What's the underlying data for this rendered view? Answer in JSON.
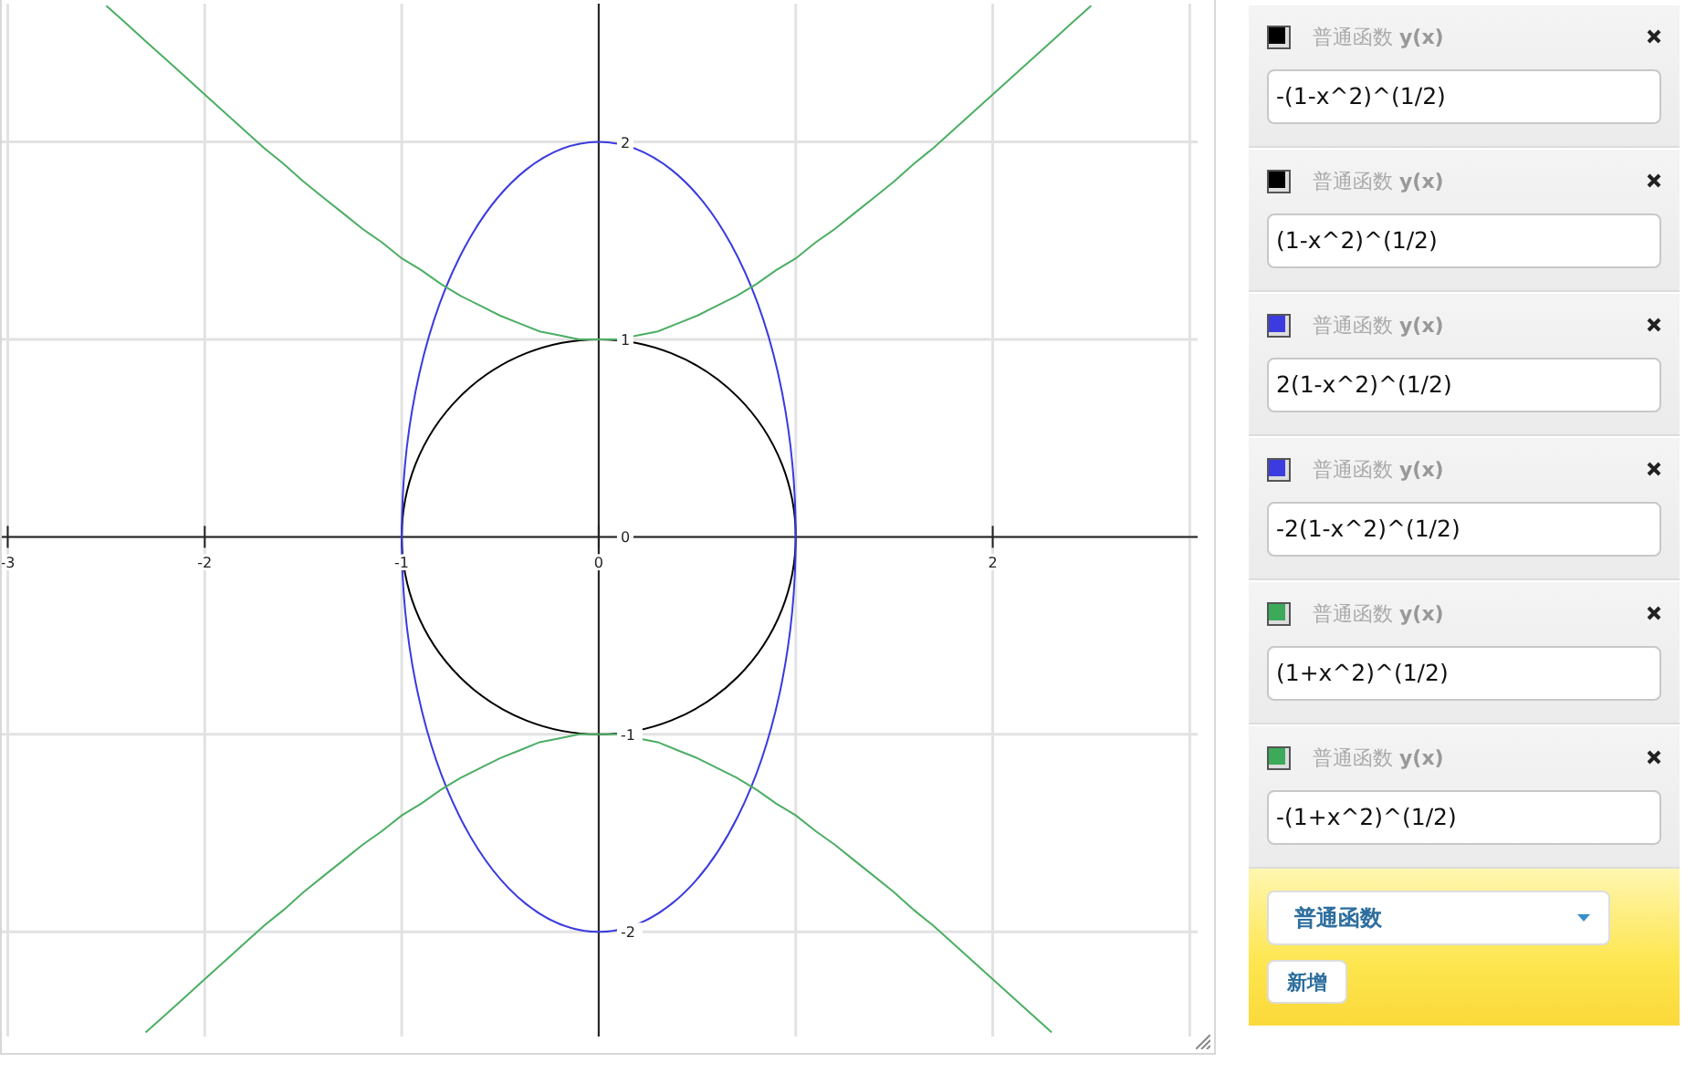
{
  "graph": {
    "chart_data": {
      "type": "line",
      "x": [
        -2.5,
        -2.4,
        -2.3,
        -2.2,
        -2.1,
        -2,
        -1.9,
        -1.8,
        -1.7,
        -1.6,
        -1.5,
        -1.4,
        -1.3,
        -1.2,
        -1.1,
        -1,
        -0.9,
        -0.8,
        -0.7,
        -0.6,
        -0.5,
        -0.4,
        -0.3,
        -0.2,
        -0.1,
        0,
        0.1,
        0.2,
        0.3,
        0.4,
        0.5,
        0.6,
        0.7,
        0.8,
        0.9,
        1,
        1.1,
        1.2,
        1.3,
        1.4,
        1.5,
        1.6,
        1.7,
        1.8,
        1.9,
        2,
        2.1,
        2.2,
        2.3,
        2.4,
        2.5
      ],
      "series": [
        {
          "color": "#4cae64",
          "values": [
            2.69,
            2.6,
            2.51,
            2.42,
            2.33,
            2.24,
            2.15,
            2.06,
            1.97,
            1.89,
            1.8,
            1.72,
            1.64,
            1.56,
            1.49,
            1.41,
            1.35,
            1.28,
            1.22,
            1.17,
            1.12,
            1.08,
            1.04,
            1.02,
            1,
            1,
            1,
            1.02,
            1.04,
            1.08,
            1.12,
            1.17,
            1.22,
            1.28,
            1.35,
            1.41,
            1.49,
            1.56,
            1.64,
            1.72,
            1.8,
            1.89,
            1.97,
            2.06,
            2.15,
            2.24,
            2.33,
            2.42,
            2.51,
            2.6,
            2.69
          ]
        },
        {
          "color": "#4cae64",
          "values": [
            null,
            null,
            -2.51,
            -2.42,
            -2.33,
            -2.24,
            -2.15,
            -2.06,
            -1.97,
            -1.89,
            -1.8,
            -1.72,
            -1.64,
            -1.56,
            -1.49,
            -1.41,
            -1.35,
            -1.28,
            -1.22,
            -1.17,
            -1.12,
            -1.08,
            -1.04,
            -1.02,
            -1,
            -1,
            -1,
            -1.02,
            -1.04,
            -1.08,
            -1.12,
            -1.17,
            -1.22,
            -1.28,
            -1.35,
            -1.41,
            -1.49,
            -1.56,
            -1.64,
            -1.72,
            -1.8,
            -1.89,
            -1.97,
            -2.06,
            -2.15,
            -2.24,
            -2.33,
            -2.42,
            -2.51,
            null,
            null
          ]
        }
      ],
      "xlim": [
        -3.03,
        3.04
      ],
      "ylim": [
        -2.53,
        2.7
      ],
      "xticks": [
        -3,
        -2,
        -1,
        0,
        2
      ],
      "yticks": [
        -2,
        -1,
        0,
        1,
        2
      ],
      "grid": true
    }
  },
  "functions": [
    {
      "label": "普通函数 **y(x)**",
      "expression": "-(1-x^2)^(1/2)",
      "color": "#000000"
    },
    {
      "label": "普通函数 **y(x)**",
      "expression": "(1-x^2)^(1/2)",
      "color": "#000000"
    },
    {
      "label": "普通函数 **y(x)**",
      "expression": "2(1-x^2)^(1/2)",
      "color": "#3b3bdf"
    },
    {
      "label": "普通函数 **y(x)**",
      "expression": "-2(1-x^2)^(1/2)",
      "color": "#3b3bdf"
    },
    {
      "label": "普通函数 **y(x)**",
      "expression": "(1+x^2)^(1/2)",
      "color": "#3caa5a"
    },
    {
      "label": "普通函数 **y(x)**",
      "expression": "-(1+x^2)^(1/2)",
      "color": "#3caa5a"
    }
  ],
  "add_panel": {
    "type_select": "普通函数",
    "add_button": "新增"
  }
}
